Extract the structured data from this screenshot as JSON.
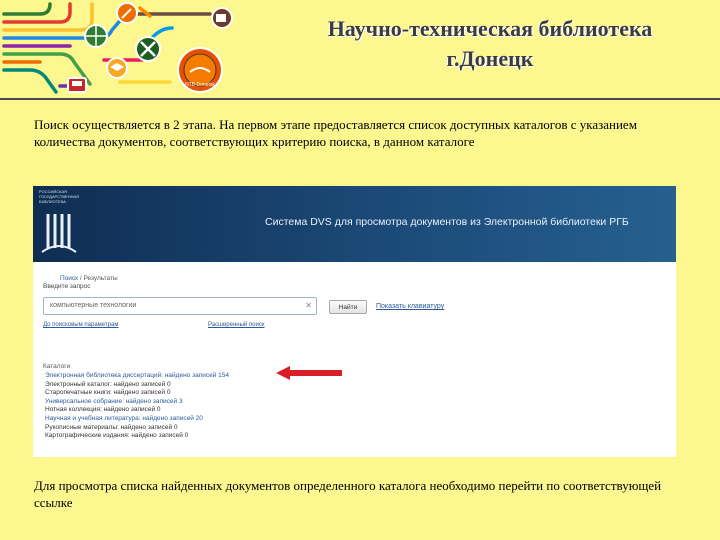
{
  "slide": {
    "title_line1": "Научно-техническая библиотека",
    "title_line2": "г.Донецк",
    "paragraph1": "Поиск осуществляется в 2 этапа. На первом этапе предоставляется список доступных каталогов с указанием количества документов, соответствующих критерию поиска, в данном каталоге",
    "paragraph2": "Для просмотра списка найденных документов определенного каталога необходимо перейти по соответствующей ссылке",
    "colors": {
      "background": "#fdf78f",
      "arrow": "#d81f26",
      "header_bar": "#1c4a78"
    },
    "banner_icons": [
      "wrench-icon",
      "key-icon",
      "globe-icon",
      "tools-icon",
      "cap-icon",
      "book-seal-icon",
      "bus-icon"
    ],
    "seal_text": "NTB Donetsk"
  },
  "screenshot": {
    "logo_text": "РОССИЙСКАЯ ГОСУДАРСТВЕННАЯ БИБЛИОТЕКА",
    "header_title": "Система DVS для просмотра документов из Электронной библиотеки РГБ",
    "breadcrumb": {
      "search": "Поиск",
      "separator": " / ",
      "results": "Результаты"
    },
    "enter_query_label": "Введите запрос",
    "search_value": "компьютерные технологии",
    "find_button": "Найти",
    "keyboard_link": "Показать клавиатуру",
    "search_params_link": "До поисковым параметрам",
    "advanced_search_link": "Расширенный поиск",
    "catalogs_heading": "Каталоги",
    "catalogs": [
      {
        "text": "Электронная библиотека диссертаций: найдено записей 154",
        "link": true
      },
      {
        "text": "Электронный каталог: найдено записей 0",
        "link": false
      },
      {
        "text": "Старопечатные книги: найдено записей 0",
        "link": false
      },
      {
        "text": "Универсальное собрание: найдено записей 3",
        "link": true
      },
      {
        "text": "Нотная коллекция: найдено записей 0",
        "link": false
      },
      {
        "text": "Научная и учебная литература: найдено записей 20",
        "link": true
      },
      {
        "text": "Рукописные материалы: найдено записей 0",
        "link": false
      },
      {
        "text": "Картографические издания: найдено записей 0",
        "link": false
      }
    ]
  }
}
